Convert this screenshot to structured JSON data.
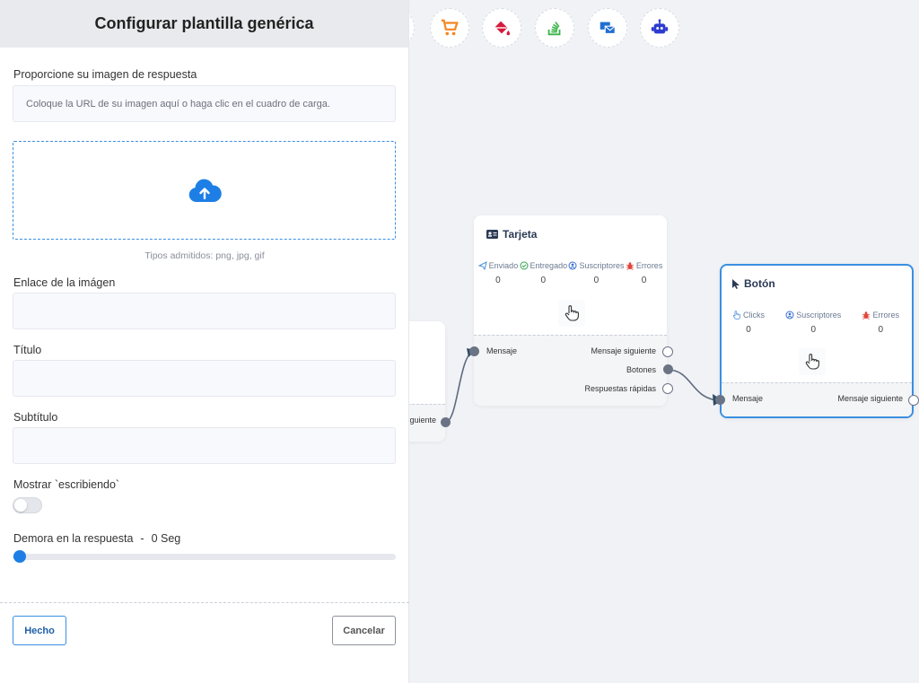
{
  "panel": {
    "title": "Configurar plantilla genérica",
    "image_label": "Proporcione su imagen de respuesta",
    "image_url_placeholder": "Coloque la URL de su imagen aquí o haga clic en el cuadro de carga.",
    "upload_hint": "Tipos admitidos: png, jpg, gif",
    "link_label": "Enlace de la imágen",
    "link_value": "",
    "title_label": "Título",
    "title_value": "",
    "subtitle_label": "Subtítulo",
    "subtitle_value": "",
    "typing_label": "Mostrar `escribiendo`",
    "typing_enabled": false,
    "delay_label": "Demora en la respuesta",
    "delay_sep": "-",
    "delay_value": "0 Seg",
    "delay_fraction": 0,
    "done_button": "Hecho",
    "cancel_button": "Cancelar"
  },
  "toolbar": {
    "tools": [
      {
        "icon": "cart-icon",
        "color": "#f5871f"
      },
      {
        "icon": "paint-bucket-icon",
        "color": "#d61a3c"
      },
      {
        "icon": "stack-overflow-icon",
        "color": "#3cb44a"
      },
      {
        "icon": "mail-bulk-icon",
        "color": "#1f6fd1"
      },
      {
        "icon": "robot-icon",
        "color": "#2d3ccf"
      }
    ]
  },
  "nodes": {
    "partial": {
      "next_message": "guiente"
    },
    "card": {
      "title": "Tarjeta",
      "stats": [
        {
          "label": "Enviado",
          "value": "0",
          "icon": "paper-plane-icon",
          "color": "#4a90d9"
        },
        {
          "label": "Entregado",
          "value": "0",
          "icon": "check-circle-icon",
          "color": "#2ea44f"
        },
        {
          "label": "Suscriptores",
          "value": "0",
          "icon": "user-circle-icon",
          "color": "#3b6fd6"
        },
        {
          "label": "Errores",
          "value": "0",
          "icon": "bug-icon",
          "color": "#e0463a"
        }
      ],
      "input_port": "Mensaje",
      "output_ports": [
        "Mensaje siguiente",
        "Botones",
        "Respuestas rápidas"
      ]
    },
    "button": {
      "title": "Botón",
      "stats": [
        {
          "label": "Clicks",
          "value": "0",
          "icon": "pointer-icon",
          "color": "#4a90d9"
        },
        {
          "label": "Suscriptores",
          "value": "0",
          "icon": "user-circle-icon",
          "color": "#3b6fd6"
        },
        {
          "label": "Errores",
          "value": "0",
          "icon": "bug-icon",
          "color": "#e0463a"
        }
      ],
      "input_port": "Mensaje",
      "output_port": "Mensaje siguiente",
      "border_color": "#3a8fe2"
    }
  },
  "colors": {
    "accent": "#1d7fe5",
    "panel_header": "#e9eaee",
    "canvas": "#f0f2f6"
  }
}
